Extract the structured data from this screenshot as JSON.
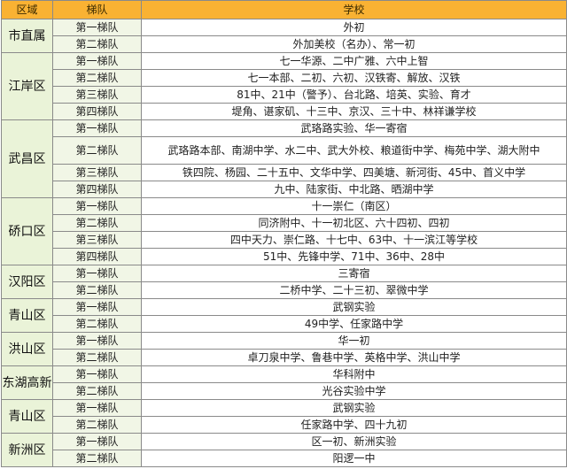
{
  "headers": {
    "district": "区域",
    "tier": "梯队",
    "school": "学校"
  },
  "groups": [
    {
      "district": "市直属",
      "rows": [
        {
          "tier": "第一梯队",
          "schools": "外初"
        },
        {
          "tier": "第二梯队",
          "schools": "外加美校（名办）、常一初"
        }
      ]
    },
    {
      "district": "江岸区",
      "rows": [
        {
          "tier": "第一梯队",
          "schools": "七一华源、二中广雅、六中上智"
        },
        {
          "tier": "第二梯队",
          "schools": "七一本部、二初、六初、汉铁寄、解放、汉铁"
        },
        {
          "tier": "第三梯队",
          "schools": "81中、21中（警予）、台北路、培英、实验、育才"
        },
        {
          "tier": "第四梯队",
          "schools": "堤角、谌家矶、十三中、京汉、三十中、林祥谦学校"
        }
      ]
    },
    {
      "district": "武昌区",
      "rows": [
        {
          "tier": "第一梯队",
          "schools": "武珞路实验、华一寄宿"
        },
        {
          "tier": "第二梯队",
          "schools": "武珞路本部、南湖中学、水二中、武大外校、粮道街中学、梅苑中学、湖大附中",
          "tall": true
        },
        {
          "tier": "第三梯队",
          "schools": "铁四院、杨园、二十五中、文华中学、四美塘、新河街、45中、首义中学"
        },
        {
          "tier": "第四梯队",
          "schools": "九中、陆家街、中北路、晒湖中学"
        }
      ]
    },
    {
      "district": "硚口区",
      "rows": [
        {
          "tier": "第一梯队",
          "schools": "十一崇仁（南区）"
        },
        {
          "tier": "第二梯队",
          "schools": "同济附中、十一初北区、六十四初、四初"
        },
        {
          "tier": "第三梯队",
          "schools": "四中天力、崇仁路、十七中、63中、十一滨江等学校"
        },
        {
          "tier": "第四梯队",
          "schools": "51中、先锋中学、71中、36中、28中"
        }
      ]
    },
    {
      "district": "汉阳区",
      "rows": [
        {
          "tier": "第一梯队",
          "schools": "三寄宿"
        },
        {
          "tier": "第二梯队",
          "schools": "二桥中学、二十三初、翠微中学"
        }
      ]
    },
    {
      "district": "青山区",
      "rows": [
        {
          "tier": "第一梯队",
          "schools": "武钢实验"
        },
        {
          "tier": "第二梯队",
          "schools": "49中学、任家路中学"
        }
      ]
    },
    {
      "district": "洪山区",
      "rows": [
        {
          "tier": "第一梯队",
          "schools": "华一初"
        },
        {
          "tier": "第二梯队",
          "schools": "卓刀泉中学、鲁巷中学、英格中学、洪山中学"
        }
      ]
    },
    {
      "district": "东湖高新",
      "rows": [
        {
          "tier": "第一梯队",
          "schools": "华科附中"
        },
        {
          "tier": "第二梯队",
          "schools": "光谷实验中学"
        }
      ]
    },
    {
      "district": "青山区",
      "rows": [
        {
          "tier": "第一梯队",
          "schools": "武钢实验"
        },
        {
          "tier": "第二梯队",
          "schools": "任家路中学、四十九初"
        }
      ]
    },
    {
      "district": "新洲区",
      "rows": [
        {
          "tier": "第一梯队",
          "schools": "区一初、新洲实验"
        },
        {
          "tier": "第二梯队",
          "schools": "阳逻一中"
        }
      ]
    }
  ]
}
